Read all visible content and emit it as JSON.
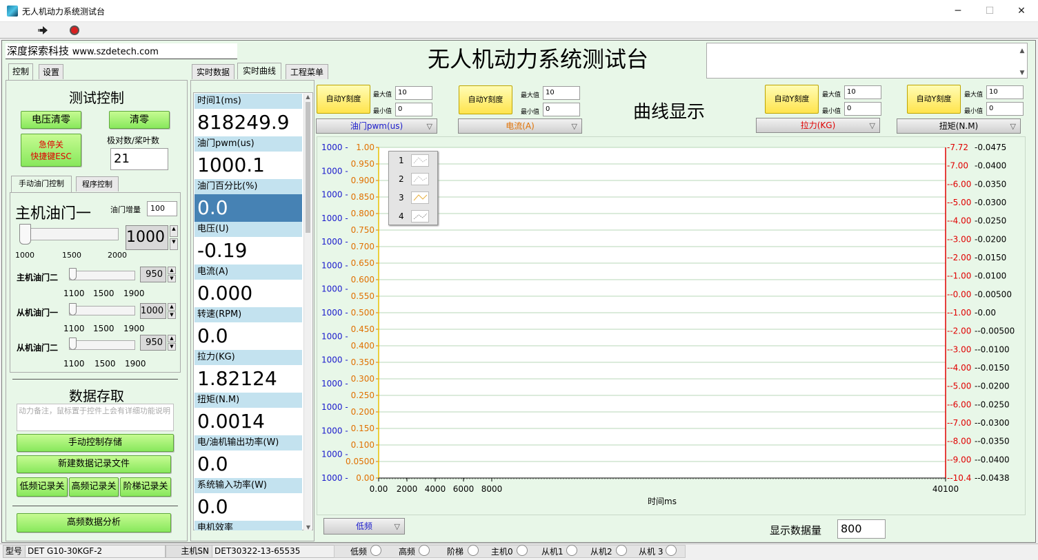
{
  "window": {
    "title": "无人机动力系统测试台",
    "minimize": "─",
    "maximize": "☐",
    "close": "✕"
  },
  "company": {
    "name": "深度探索科技",
    "url": "www.szdetech.com"
  },
  "app_title": "无人机动力系统测试台",
  "left_tabs": [
    "控制",
    "设置"
  ],
  "test_control": {
    "heading": "测试控制",
    "btn_voltage_zero": "电压清零",
    "btn_zero": "清零",
    "btn_estop_line1": "急停关",
    "btn_estop_line2": "快捷键ESC",
    "poles_label": "极对数/桨叶数",
    "poles_value": "21"
  },
  "sub_tabs": [
    "手动油门控制",
    "程序控制"
  ],
  "manual": {
    "main_throttle1_label": "主机油门一",
    "increment_label": "油门增量",
    "increment_value": "100",
    "main_throttle1_value": "1000",
    "main_throttle1_ticks": [
      "1000",
      "1500",
      "2000"
    ],
    "sliders": [
      {
        "label": "主机油门二",
        "value": "950",
        "ticks": [
          "1100",
          "1500",
          "1900"
        ]
      },
      {
        "label": "从机油门一",
        "value": "1000",
        "ticks": [
          "1100",
          "1500",
          "1900"
        ]
      },
      {
        "label": "从机油门二",
        "value": "950",
        "ticks": [
          "1100",
          "1500",
          "1900"
        ]
      }
    ]
  },
  "storage": {
    "heading": "数据存取",
    "note_placeholder": "动力备注，鼠标置于控件上会有详细功能说明",
    "btn_manual_save": "手动控制存储",
    "btn_new_file": "新建数据记录文件",
    "btn_low": "低频记录关",
    "btn_high": "高频记录关",
    "btn_step": "阶梯记录关",
    "btn_analysis": "高频数据分析"
  },
  "center_tabs": [
    "实时数据",
    "实时曲线",
    "工程菜单"
  ],
  "readings": [
    {
      "label": "时间1(ms)",
      "value": "818249.9"
    },
    {
      "label": "油门pwm(us)",
      "value": "1000.1"
    },
    {
      "label": "油门百分比(%)",
      "value": "0.0"
    },
    {
      "label": "电压(U)",
      "value": "-0.19"
    },
    {
      "label": "电流(A)",
      "value": "0.000"
    },
    {
      "label": "转速(RPM)",
      "value": "0.0"
    },
    {
      "label": "拉力(KG)",
      "value": "1.82124"
    },
    {
      "label": "扭矩(N.M)",
      "value": "0.0014"
    },
    {
      "label": "电/油机输出功率(W)",
      "value": "0.0"
    },
    {
      "label": "系统输入功率(W)",
      "value": "0.0"
    },
    {
      "label": "电机效率",
      "value": ""
    }
  ],
  "curve": {
    "heading": "曲线显示",
    "auto_label": "自动Y刻度",
    "max_label": "最大值",
    "min_label": "最小值",
    "axes": [
      {
        "channel": "油门pwm(us)",
        "color": "#1a1acc",
        "max": "10",
        "min": "0"
      },
      {
        "channel": "电流(A)",
        "color": "#e07000",
        "max": "10",
        "min": "0"
      },
      {
        "channel": "拉力(KG)",
        "color": "#e00000",
        "max": "10",
        "min": "0"
      },
      {
        "channel": "扭矩(N.M)",
        "color": "#000000",
        "max": "10",
        "min": "0"
      }
    ],
    "legend": [
      "1",
      "2",
      "3",
      "4"
    ],
    "sample_mode": "低频",
    "display_count_label": "显示数据量",
    "display_count_value": "800"
  },
  "chart_data": {
    "type": "line",
    "title": "",
    "xlabel": "时间ms",
    "x_ticks": [
      "0.00",
      "2000",
      "4000",
      "6000",
      "8000",
      "40100"
    ],
    "xlim": [
      0,
      40100
    ],
    "y_axes": [
      {
        "side": "left-outer",
        "color": "#1a1acc",
        "ticks": [
          "1000",
          "1000",
          "1000",
          "1000",
          "1000",
          "1000",
          "1000",
          "1000",
          "1000",
          "1000",
          "1000",
          "1000",
          "1000",
          "1000",
          "1000"
        ]
      },
      {
        "side": "left-inner",
        "color": "#e07000",
        "ticks": [
          "1.00",
          "0.950",
          "0.900",
          "0.850",
          "0.800",
          "0.750",
          "0.700",
          "0.650",
          "0.600",
          "0.550",
          "0.500",
          "0.450",
          "0.400",
          "0.350",
          "0.300",
          "0.250",
          "0.200",
          "0.150",
          "0.100",
          "0.0500",
          "0.00"
        ],
        "ylim": [
          0,
          1
        ]
      },
      {
        "side": "right-inner",
        "color": "#e00000",
        "ticks": [
          "7.72",
          "7.00",
          "-6.00",
          "-5.00",
          "-4.00",
          "-3.00",
          "-2.00",
          "-1.00",
          "-0.00",
          "-1.00",
          "-2.00",
          "-3.00",
          "-4.00",
          "-5.00",
          "-6.00",
          "-7.00",
          "-8.00",
          "-9.00",
          "-10.4"
        ]
      },
      {
        "side": "right-outer",
        "color": "#000000",
        "ticks": [
          "0.0475",
          "0.0400",
          "0.0350",
          "0.0300",
          "0.0250",
          "0.0200",
          "0.0150",
          "0.0100",
          "0.00500",
          "0.00",
          "-0.00500",
          "-0.0100",
          "-0.0150",
          "-0.0200",
          "-0.0250",
          "-0.0300",
          "-0.0350",
          "-0.0400",
          "-0.0438"
        ]
      }
    ],
    "series": [],
    "grid": true
  },
  "status": {
    "model_label": "型号",
    "model_value": "DET G10-30KGF-2",
    "sn_label": "主机SN",
    "sn_value": "DET30322-13-65535",
    "leds": [
      "低频",
      "高频",
      "阶梯",
      "主机0",
      "从机1",
      "从机2",
      "从机 3"
    ]
  }
}
